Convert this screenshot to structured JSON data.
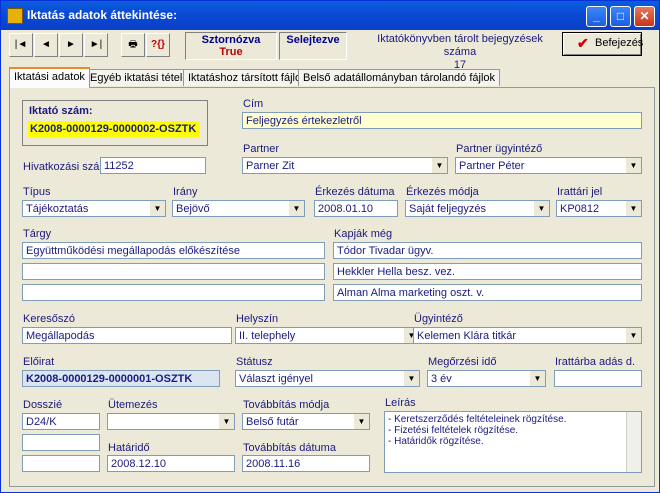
{
  "window": {
    "title": "Iktatás adatok áttekintése:"
  },
  "toolbar": {
    "nav": [
      "|◄",
      "◄",
      "►",
      "►|"
    ],
    "sztornozva": {
      "label": "Sztornózva",
      "value": "True"
    },
    "selejtezve": {
      "label": "Selejtezve",
      "value": ""
    },
    "stat_label": "Iktatókönyvben tárolt bejegyzések száma",
    "stat_value": "17",
    "save_label": "Befejezés"
  },
  "tabs": [
    "Iktatási adatok",
    "Egyéb iktatási tételek",
    "Iktatáshoz társított fájlok",
    "Belső adatállományban tárolandó fájlok"
  ],
  "form": {
    "iktato_szam": {
      "label": "Iktató szám:",
      "value": "K2008-0000129-0000002-OSZTK"
    },
    "cim": {
      "label": "Cím",
      "value": "Feljegyzés értekezletről"
    },
    "hivatkozasi_szam": {
      "label": "Hivatkozási szám:",
      "value": "11252"
    },
    "partner": {
      "label": "Partner",
      "value": "Parner Zit"
    },
    "partner_ugyintezo": {
      "label": "Partner ügyintéző",
      "value": "Partner Péter"
    },
    "tipus": {
      "label": "Típus",
      "value": "Tájékoztatás"
    },
    "irany": {
      "label": "Irány",
      "value": "Bejövő"
    },
    "erkezes_datuma": {
      "label": "Érkezés dátuma",
      "value": "2008.01.10"
    },
    "erkezes_modja": {
      "label": "Érkezés módja",
      "value": "Saját feljegyzés"
    },
    "irattari_jel": {
      "label": "Irattári jel",
      "value": "KP0812"
    },
    "targy": {
      "label": "Tárgy",
      "values": [
        "Együttműködési megállapodás előkészítése",
        "",
        ""
      ]
    },
    "kapjak_meg": {
      "label": "Kapják még",
      "values": [
        "Tódor Tivadar ügyv.",
        "Hekkler Hella besz. vez.",
        "Alman Alma marketing oszt. v."
      ]
    },
    "kereszo": {
      "label": "Keresőszó",
      "value": "Megállapodás"
    },
    "helyszin": {
      "label": "Helyszín",
      "value": "II. telephely"
    },
    "ugyintezo": {
      "label": "Ügyintéző",
      "value": "Kelemen Klára titkár"
    },
    "eloirat": {
      "label": "Előirat",
      "value": "K2008-0000129-0000001-OSZTK"
    },
    "statusz": {
      "label": "Státusz",
      "value": "Választ igényel"
    },
    "megorzesi_ido": {
      "label": "Megőrzési idő",
      "value": "3 év"
    },
    "irattarba_adas": {
      "label": "Irattárba adás d.",
      "value": ""
    },
    "dosszie": {
      "label": "Dosszié",
      "values": [
        "D24/K",
        "",
        ""
      ]
    },
    "utemezes": {
      "label": "Ütemezés",
      "value": ""
    },
    "tovabbitas_modja": {
      "label": "Továbbítás módja",
      "value": "Belső futár"
    },
    "leiras": {
      "label": "Leírás",
      "lines": [
        "- Keretszerződés feltételeinek rögzítése.",
        "- Fizetési feltételek rögzítése.",
        "- Határidők rögzítése."
      ]
    },
    "hatarido": {
      "label": "Határidő",
      "value": "2008.12.10"
    },
    "tovabbitas_datuma": {
      "label": "Továbbítás dátuma",
      "value": "2008.11.16"
    }
  }
}
